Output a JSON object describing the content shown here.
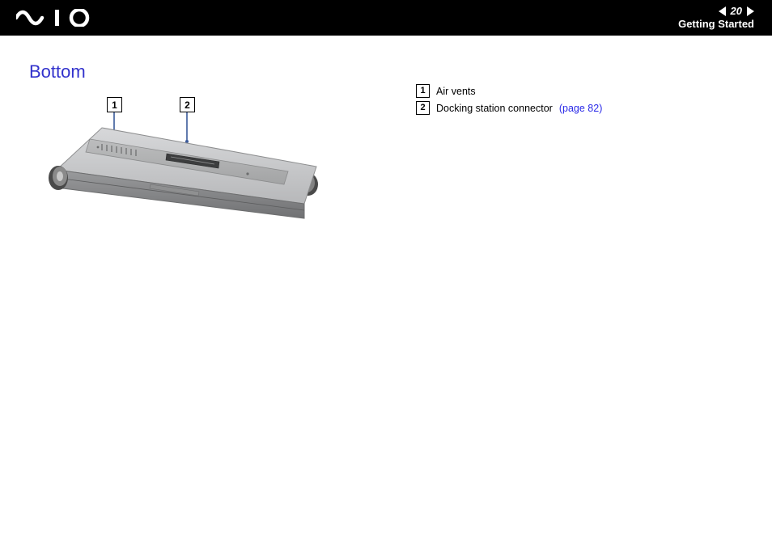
{
  "header": {
    "page_number": "20",
    "section": "Getting Started"
  },
  "content": {
    "heading": "Bottom",
    "callouts": {
      "c1": "1",
      "c2": "2"
    },
    "legend": [
      {
        "num": "1",
        "text": "Air vents",
        "link": ""
      },
      {
        "num": "2",
        "text": "Docking station connector",
        "link": "(page 82)"
      }
    ]
  }
}
